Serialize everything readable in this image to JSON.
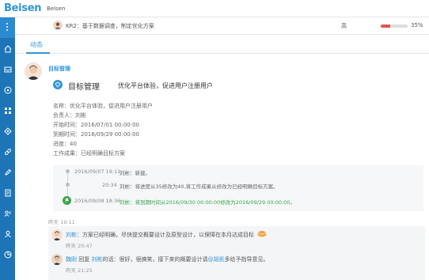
{
  "topbar": {
    "logo": "Beisen",
    "brand": "Beisen"
  },
  "kr": {
    "label": "KR2：基于数据调查，制定优化方案",
    "right_label": "高",
    "progress_pct": 35,
    "pct_label": "35%"
  },
  "tab": {
    "label": "动态"
  },
  "post": {
    "author": "目标管理",
    "goal_type": "目标管理",
    "goal_title": "优化平台体验，促进用户注册用户",
    "fields": [
      {
        "k": "名称：",
        "v": "优化平台体验，促进用户注册用户"
      },
      {
        "k": "负责人：",
        "v": "刘彬"
      },
      {
        "k": "开始时间：",
        "v": "2016/07/01 00:00:00"
      },
      {
        "k": "到期时间：",
        "v": "2016/09/29 00:00:00"
      },
      {
        "k": "进度：",
        "v": "40"
      },
      {
        "k": "工作成果：",
        "v": "已经明确目标方案"
      }
    ],
    "timeline": [
      {
        "ts": "2016/09/07 19:11",
        "who": "刘彬",
        "text": "新建。"
      },
      {
        "ts": "20:34",
        "who": "刘彬",
        "text": "将进度从35修改为40,将工作成果从修改为已经明确目标方案。"
      },
      {
        "ts": "2016/09/08 18:36",
        "who": "刘彬",
        "text": "将到期时间从2016/09/30 00:00:00修改为2016/09/29 00:00:00。"
      }
    ],
    "post_time": "昨天 19:11"
  },
  "comments": [
    {
      "name": "刘彬",
      "text": "方案已经明确，尽快提交概要设计及原型设计，以保障在本月达成目标",
      "time": "昨天 20:47"
    },
    {
      "name": "魏刚",
      "verb": "回复",
      "target": "刘彬",
      "text_prefix": "的话：很好，很搞笑，接下来的概要设计请",
      "mention": "@胡凯",
      "text_suffix": "多给予指导意见。",
      "time": "昨天 21:25"
    }
  ],
  "colors": {
    "accent": "#2f95d6",
    "sidebar": "#1d75b8",
    "green": "#3aa54a",
    "progress": "#e55353"
  }
}
